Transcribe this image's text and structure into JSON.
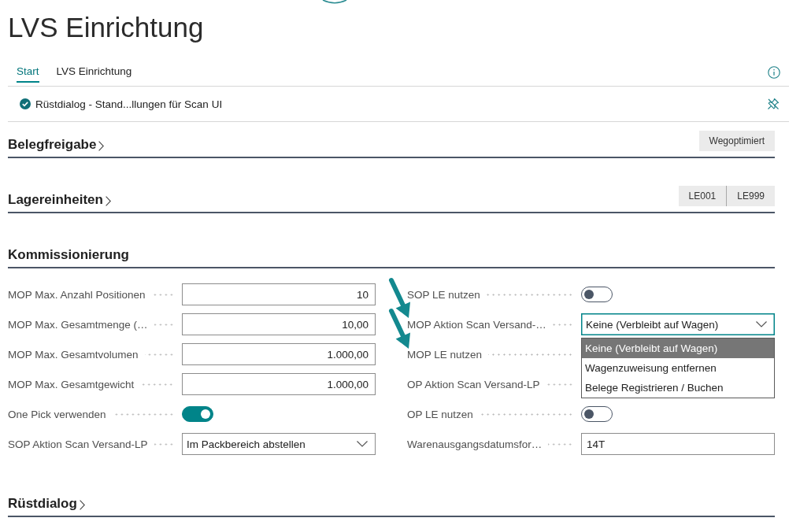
{
  "page": {
    "title": "LVS Einrichtung"
  },
  "tabs": [
    {
      "label": "Start",
      "selected": true
    },
    {
      "label": "LVS Einrichtung",
      "selected": false
    }
  ],
  "notification": {
    "text": "Rüstdialog - Stand...llungen für Scan UI"
  },
  "sections": [
    {
      "title": "Belegfreigabe",
      "expanded": false,
      "actions": [
        "Wegoptimiert"
      ]
    },
    {
      "title": "Lagereinheiten",
      "expanded": false,
      "actions": [
        "LE001",
        "LE999"
      ]
    },
    {
      "title": "Kommissionierung",
      "expanded": true,
      "fields_left": [
        {
          "kind": "number",
          "label": "MOP Max. Anzahl Positionen",
          "value": "10"
        },
        {
          "kind": "number",
          "label": "MOP Max. Gesamtmenge (…",
          "value": "10,00"
        },
        {
          "kind": "number",
          "label": "MOP Max. Gesamtvolumen",
          "value": "1.000,00"
        },
        {
          "kind": "number",
          "label": "MOP Max. Gesamtgewicht",
          "value": "1.000,00"
        },
        {
          "kind": "toggle",
          "label": "One Pick verwenden",
          "on": true
        },
        {
          "kind": "select",
          "label": "SOP Aktion Scan Versand-LP",
          "value": "Im Packbereich abstellen",
          "open": false
        }
      ],
      "fields_right": [
        {
          "kind": "toggle",
          "label": "SOP LE nutzen",
          "on": false
        },
        {
          "kind": "select",
          "label": "MOP Aktion Scan Versand-…",
          "value": "Keine (Verbleibt auf Wagen)",
          "open": true,
          "options": [
            {
              "label": "Keine (Verbleibt auf Wagen)",
              "selected": true
            },
            {
              "label": "Wagenzuweisung entfernen",
              "selected": false
            },
            {
              "label": "Belege Registrieren / Buchen",
              "selected": false
            }
          ]
        },
        {
          "kind": "label",
          "label": "MOP LE nutzen"
        },
        {
          "kind": "label",
          "label": "OP Aktion Scan Versand-LP"
        },
        {
          "kind": "toggle",
          "label": "OP LE nutzen",
          "on": false
        },
        {
          "kind": "text",
          "label": "Warenausgangsdatumsfor…",
          "value": "14T"
        }
      ]
    },
    {
      "title": "Rüstdialog",
      "expanded": false
    }
  ]
}
